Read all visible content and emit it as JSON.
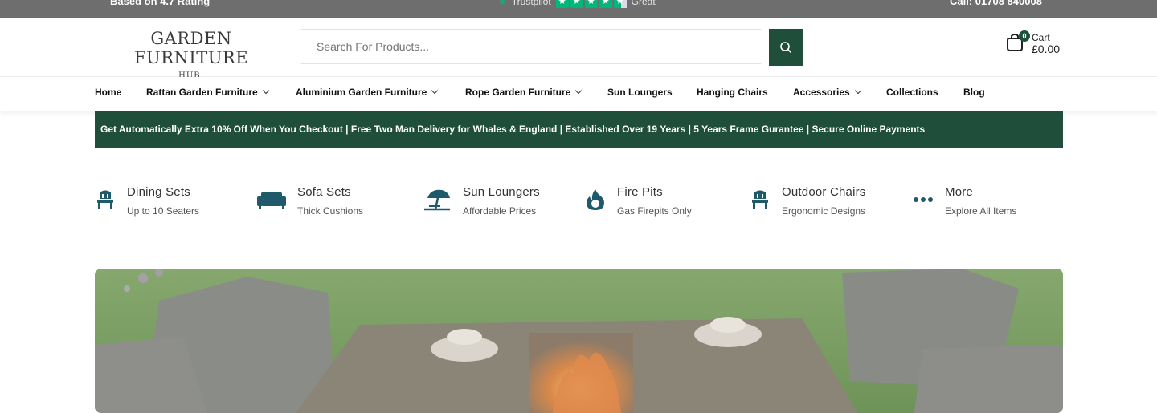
{
  "topbar": {
    "left_text": "Based on 4.7 Rating",
    "trustpilot_label": "Trustpilot",
    "rating_word": "Great",
    "right_text": "Call: 01708 840008"
  },
  "header": {
    "logo_main": "GARDEN FURNITURE",
    "logo_sub": "HUB.",
    "search_placeholder": "Search For Products...",
    "cart_label": "Cart",
    "cart_amount": "£0.00",
    "cart_count": "0"
  },
  "nav": {
    "items": [
      {
        "label": "Home"
      },
      {
        "label": "Rattan Garden Furniture"
      },
      {
        "label": "Aluminium Garden Furniture"
      },
      {
        "label": "Rope Garden Furniture"
      },
      {
        "label": "Sun Loungers"
      },
      {
        "label": "Hanging Chairs"
      },
      {
        "label": "Accessories"
      },
      {
        "label": "Collections"
      },
      {
        "label": "Blog"
      }
    ]
  },
  "promo": {
    "text": "Get Automatically Extra 10% Off When You Checkout |  Free Two Man Delivery for Whales & England  |  Established Over 19 Years |  5 Years Frame Gurantee  | Secure Online Payments"
  },
  "categories": [
    {
      "title": "Dining Sets",
      "subtitle": "Up to 10 Seaters",
      "icon": "dining-chair-icon"
    },
    {
      "title": "Sofa Sets",
      "subtitle": "Thick Cushions",
      "icon": "sofa-icon"
    },
    {
      "title": "Sun Loungers",
      "subtitle": "Affordable Prices",
      "icon": "beach-umbrella-icon"
    },
    {
      "title": "Fire Pits",
      "subtitle": "Gas Firepits Only",
      "icon": "flame-icon"
    },
    {
      "title": "Outdoor Chairs",
      "subtitle": "Ergonomic Designs",
      "icon": "chair-icon"
    },
    {
      "title": "More",
      "subtitle": "Explore All Items",
      "icon": "more-dots-icon"
    }
  ],
  "colors": {
    "brand_green": "#1f4f3a",
    "icon_teal": "#1f5a6a",
    "topbar_grey": "#6e6e6e",
    "trustpilot_green": "#00b67a"
  }
}
